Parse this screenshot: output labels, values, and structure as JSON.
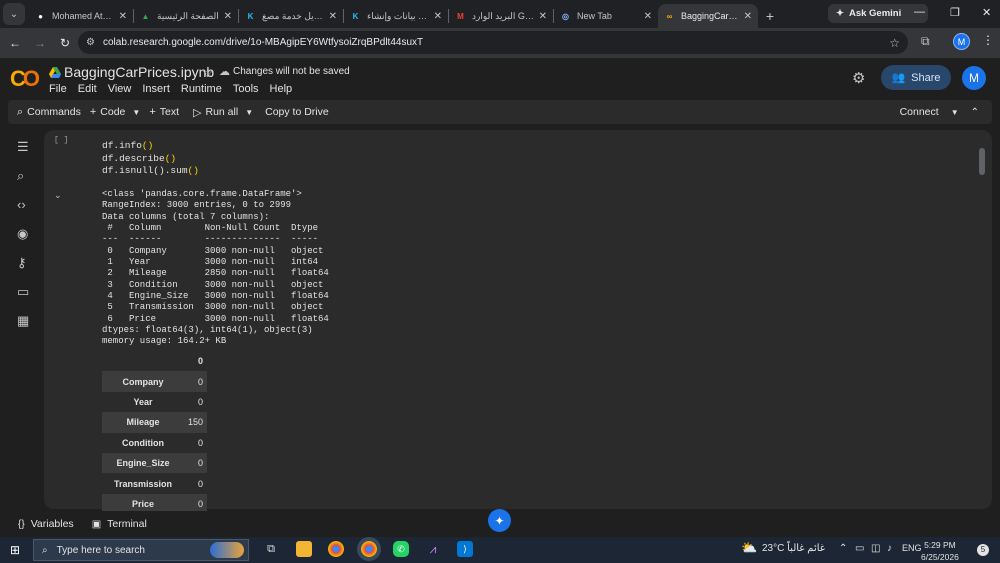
{
  "browser": {
    "tabs": [
      {
        "label": "Mohamed Atef |",
        "favicon": "github-icon",
        "active": false
      },
      {
        "label": "الصفحة الرئيسية",
        "favicon": "drive-icon",
        "active": false
      },
      {
        "label": "تعديل خدمة مصغ",
        "favicon": "k-icon",
        "active": false
      },
      {
        "label": "تحليل بيانات وإنشاء",
        "favicon": "k-icon",
        "active": false
      },
      {
        "label": "البريد الوارد Gmail",
        "favicon": "gmail-icon",
        "active": false
      },
      {
        "label": "New Tab",
        "favicon": "chrome-icon",
        "active": false
      },
      {
        "label": "BaggingCarPrices",
        "favicon": "colab-icon",
        "active": true
      }
    ],
    "gemini_label": "Ask Gemini",
    "url": "colab.research.google.com/drive/1o-MBAgipEY6WtfysoiZrqBPdlt44suxT",
    "profile_initial": "M"
  },
  "colab": {
    "logo": "CO",
    "notebook_title": "BaggingCarPrices.ipynb",
    "save_warning": "Changes will not be saved",
    "menu": [
      "File",
      "Edit",
      "View",
      "Insert",
      "Runtime",
      "Tools",
      "Help"
    ],
    "share_label": "Share",
    "avatar_initial": "M",
    "toolbar": {
      "commands": "Commands",
      "code": "Code",
      "text": "Text",
      "run_all": "Run all",
      "copy_to_drive": "Copy to Drive",
      "connect": "Connect"
    }
  },
  "cell": {
    "run_indicator": "[ ]",
    "code_lines": [
      {
        "fn": "df.info",
        "args": "()"
      },
      {
        "fn": "df.describe",
        "args": "()"
      },
      {
        "fn": "df.isnull().sum",
        "args": "()"
      }
    ],
    "output_text": "<class 'pandas.core.frame.DataFrame'>\nRangeIndex: 3000 entries, 0 to 2999\nData columns (total 7 columns):\n #   Column        Non-Null Count  Dtype  \n---  ------        --------------  -----  \n 0   Company       3000 non-null   object \n 1   Year          3000 non-null   int64  \n 2   Mileage       2850 non-null   float64\n 3   Condition     3000 non-null   object \n 4   Engine_Size   3000 non-null   float64\n 5   Transmission  3000 non-null   object \n 6   Price         3000 non-null   float64\ndtypes: float64(3), int64(1), object(3)\nmemory usage: 164.2+ KB",
    "null_table": {
      "header": "0",
      "rows": [
        {
          "name": "Company",
          "value": "0"
        },
        {
          "name": "Year",
          "value": "0"
        },
        {
          "name": "Mileage",
          "value": "150"
        },
        {
          "name": "Condition",
          "value": "0"
        },
        {
          "name": "Engine_Size",
          "value": "0"
        },
        {
          "name": "Transmission",
          "value": "0"
        },
        {
          "name": "Price",
          "value": "0"
        }
      ]
    }
  },
  "statusbar": {
    "variables": "Variables",
    "terminal": "Terminal"
  },
  "taskbar": {
    "search_placeholder": "Type here to search",
    "weather": "23°C غائم غالباً",
    "language": "ENG",
    "time": "5:29 PM",
    "date": "6/25/2026",
    "notification_count": "5"
  }
}
